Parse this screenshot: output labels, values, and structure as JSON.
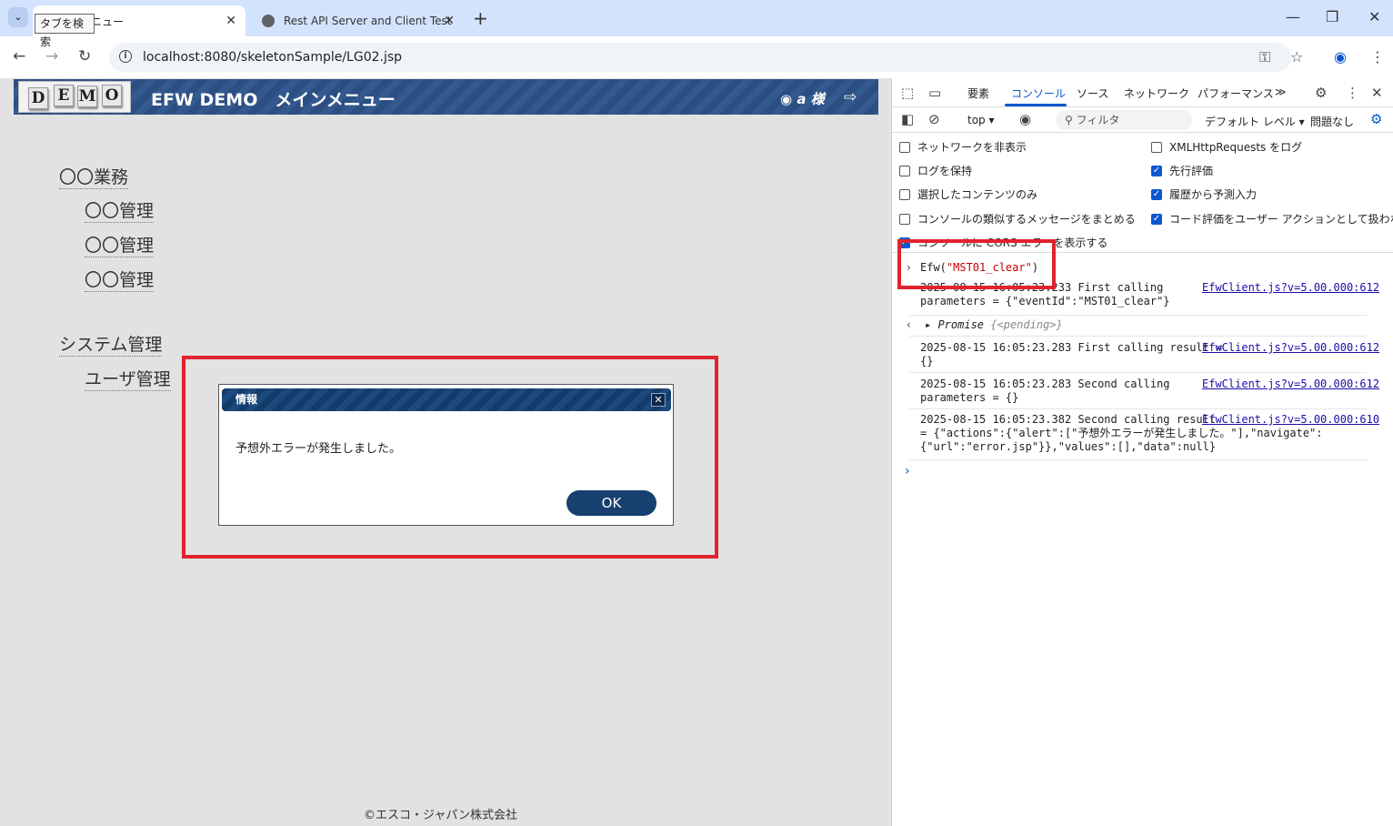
{
  "browser": {
    "tab_tooltip": "タブを検索",
    "tabs": [
      {
        "title": "ニュー",
        "close": "✕"
      },
      {
        "title": "Rest API Server and Client Test",
        "close": "✕"
      }
    ],
    "new_tab": "+",
    "url": "localhost:8080/skeletonSample/LG02.jsp"
  },
  "app": {
    "logo_letters": [
      "D",
      "E",
      "M",
      "O"
    ],
    "header_title": "EFW DEMO　メインメニュー",
    "user": "a 様",
    "menu": {
      "group1": "〇〇業務",
      "group1_items": [
        "〇〇管理",
        "〇〇管理",
        "〇〇管理"
      ],
      "group2": "システム管理",
      "group2_items": [
        "ユーザ管理"
      ]
    },
    "footer": "©エスコ・ジャパン株式会社"
  },
  "dialog": {
    "title": "情報",
    "message": "予想外エラーが発生しました。",
    "ok_label": "OK",
    "close_label": "✕"
  },
  "devtools": {
    "tabs": [
      "要素",
      "コンソール",
      "ソース",
      "ネットワーク",
      "パフォーマンス"
    ],
    "active_tab": "コンソール",
    "more": "≫",
    "context": "top ▾",
    "filter_placeholder": "フィルタ",
    "level": "デフォルト レベル ▾",
    "issues": "問題なし",
    "options": [
      {
        "label": "ネットワークを非表示",
        "checked": false
      },
      {
        "label": "XMLHttpRequests をログ",
        "checked": false
      },
      {
        "label": "ログを保持",
        "checked": false
      },
      {
        "label": "先行評価",
        "checked": true
      },
      {
        "label": "選択したコンテンツのみ",
        "checked": false
      },
      {
        "label": "履歴から予測入力",
        "checked": true
      },
      {
        "label": "コンソールの類似するメッセージをまとめる",
        "checked": false
      },
      {
        "label": "コード評価をユーザー アクションとして扱わない",
        "checked": true
      },
      {
        "label": "コンソールに CORS エラーを表示する",
        "checked": true
      }
    ],
    "console": {
      "command_prefix": "Efw(",
      "command_arg": "\"MST01_clear\"",
      "command_suffix": ")",
      "logs": [
        {
          "text": "2025-08-15 16:05:23.233 First calling\nparameters = {\"eventId\":\"MST01_clear\"}",
          "link": "EfwClient.js?v=5.00.000:612"
        },
        {
          "text": "2025-08-15 16:05:23.283 First calling result =\n{}",
          "link": "EfwClient.js?v=5.00.000:612"
        },
        {
          "text": "2025-08-15 16:05:23.283 Second calling\nparameters = {}",
          "link": "EfwClient.js?v=5.00.000:612"
        },
        {
          "text": "2025-08-15 16:05:23.382 Second calling result\n= {\"actions\":{\"alert\":[\"予想外エラーが発生しました。\"],\"navigate\":\n{\"url\":\"error.jsp\"}},\"values\":[],\"data\":null}",
          "link": "EfwClient.js?v=5.00.000:610"
        }
      ],
      "promise_label": "Promise",
      "promise_state": "{<pending>}"
    }
  }
}
